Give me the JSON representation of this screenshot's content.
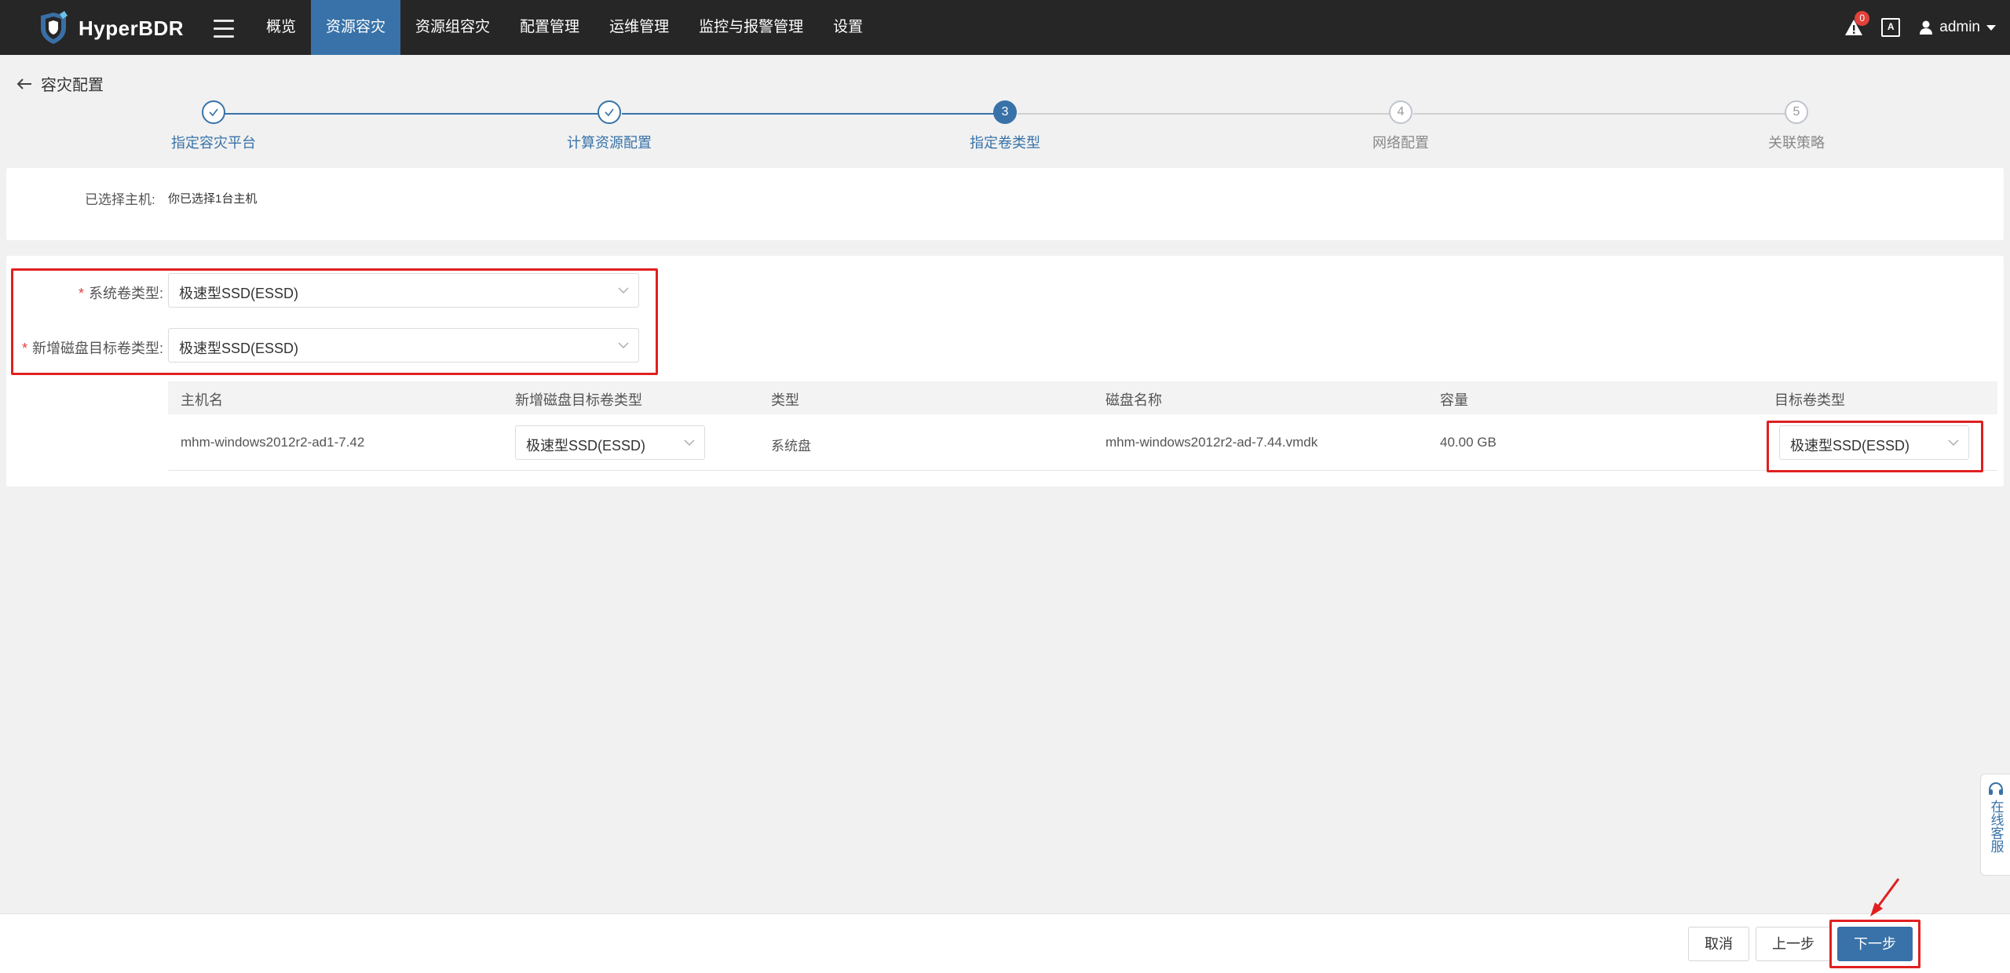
{
  "header": {
    "brand": "HyperBDR",
    "nav": [
      {
        "label": "概览",
        "active": false
      },
      {
        "label": "资源容灾",
        "active": true
      },
      {
        "label": "资源组容灾",
        "active": false
      },
      {
        "label": "配置管理",
        "active": false
      },
      {
        "label": "运维管理",
        "active": false
      },
      {
        "label": "监控与报警管理",
        "active": false
      },
      {
        "label": "设置",
        "active": false
      }
    ],
    "alert_count": "0",
    "lang_label": "A",
    "user": "admin"
  },
  "page": {
    "title": "容灾配置"
  },
  "steps": [
    {
      "index": "1",
      "label": "指定容灾平台",
      "status": "done"
    },
    {
      "index": "2",
      "label": "计算资源配置",
      "status": "done"
    },
    {
      "index": "3",
      "label": "指定卷类型",
      "status": "current"
    },
    {
      "index": "4",
      "label": "网络配置",
      "status": "pending"
    },
    {
      "index": "5",
      "label": "关联策略",
      "status": "pending"
    }
  ],
  "selected_hosts": {
    "label": "已选择主机:",
    "value": "你已选择1台主机"
  },
  "form": {
    "system_volume_label": "系统卷类型:",
    "system_volume_value": "极速型SSD(ESSD)",
    "new_disk_label": "新增磁盘目标卷类型:",
    "new_disk_value": "极速型SSD(ESSD)"
  },
  "table": {
    "headers": {
      "host": "主机名",
      "new_disk_type": "新增磁盘目标卷类型",
      "type": "类型",
      "disk_name": "磁盘名称",
      "capacity": "容量",
      "target_type": "目标卷类型"
    },
    "rows": [
      {
        "host": "mhm-windows2012r2-ad1-7.42",
        "new_disk_type": "极速型SSD(ESSD)",
        "type": "系统盘",
        "disk_name": "mhm-windows2012r2-ad-7.44.vmdk",
        "capacity": "40.00 GB",
        "target_type": "极速型SSD(ESSD)"
      }
    ]
  },
  "footer": {
    "cancel": "取消",
    "prev": "上一步",
    "next": "下一步"
  },
  "service": {
    "label": "在线客服"
  },
  "colors": {
    "primary": "#3872a8",
    "topbar": "#262626",
    "highlight": "#e02020",
    "badge": "#e3413c"
  }
}
